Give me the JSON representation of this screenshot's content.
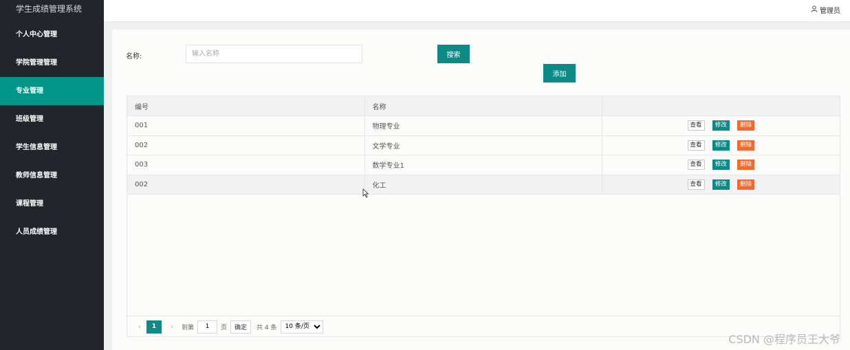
{
  "app": {
    "title": "学生成绩管理系统"
  },
  "sidebar": {
    "items": [
      {
        "label": "个人中心管理"
      },
      {
        "label": "学院管理管理"
      },
      {
        "label": "专业管理"
      },
      {
        "label": "班级管理"
      },
      {
        "label": "学生信息管理"
      },
      {
        "label": "教师信息管理"
      },
      {
        "label": "课程管理"
      },
      {
        "label": "人员成绩管理"
      }
    ],
    "active_index": 2
  },
  "header": {
    "user": "管理员",
    "user_icon": "user-icon"
  },
  "search": {
    "label": "名称:",
    "placeholder": "输入名称",
    "value": "",
    "button": "搜索"
  },
  "add_button": "添加",
  "table": {
    "columns": [
      "编号",
      "名称",
      ""
    ],
    "rows": [
      {
        "id": "001",
        "name": "物理专业"
      },
      {
        "id": "002",
        "name": "文学专业"
      },
      {
        "id": "003",
        "name": "数学专业1"
      },
      {
        "id": "002",
        "name": "化工"
      }
    ],
    "actions": {
      "view": "查看",
      "edit": "修改",
      "delete": "删除"
    }
  },
  "pagination": {
    "prev": "‹",
    "current": "1",
    "next": "›",
    "goto_label": "到第",
    "goto_value": "1",
    "page_unit": "页",
    "confirm": "确定",
    "total": "共 4 条",
    "page_size": "10 条/页"
  },
  "watermark": "CSDN @程序员王大爷",
  "colors": {
    "sidebar_bg": "#22252b",
    "accent": "#0e8a86",
    "danger": "#f0692e"
  }
}
